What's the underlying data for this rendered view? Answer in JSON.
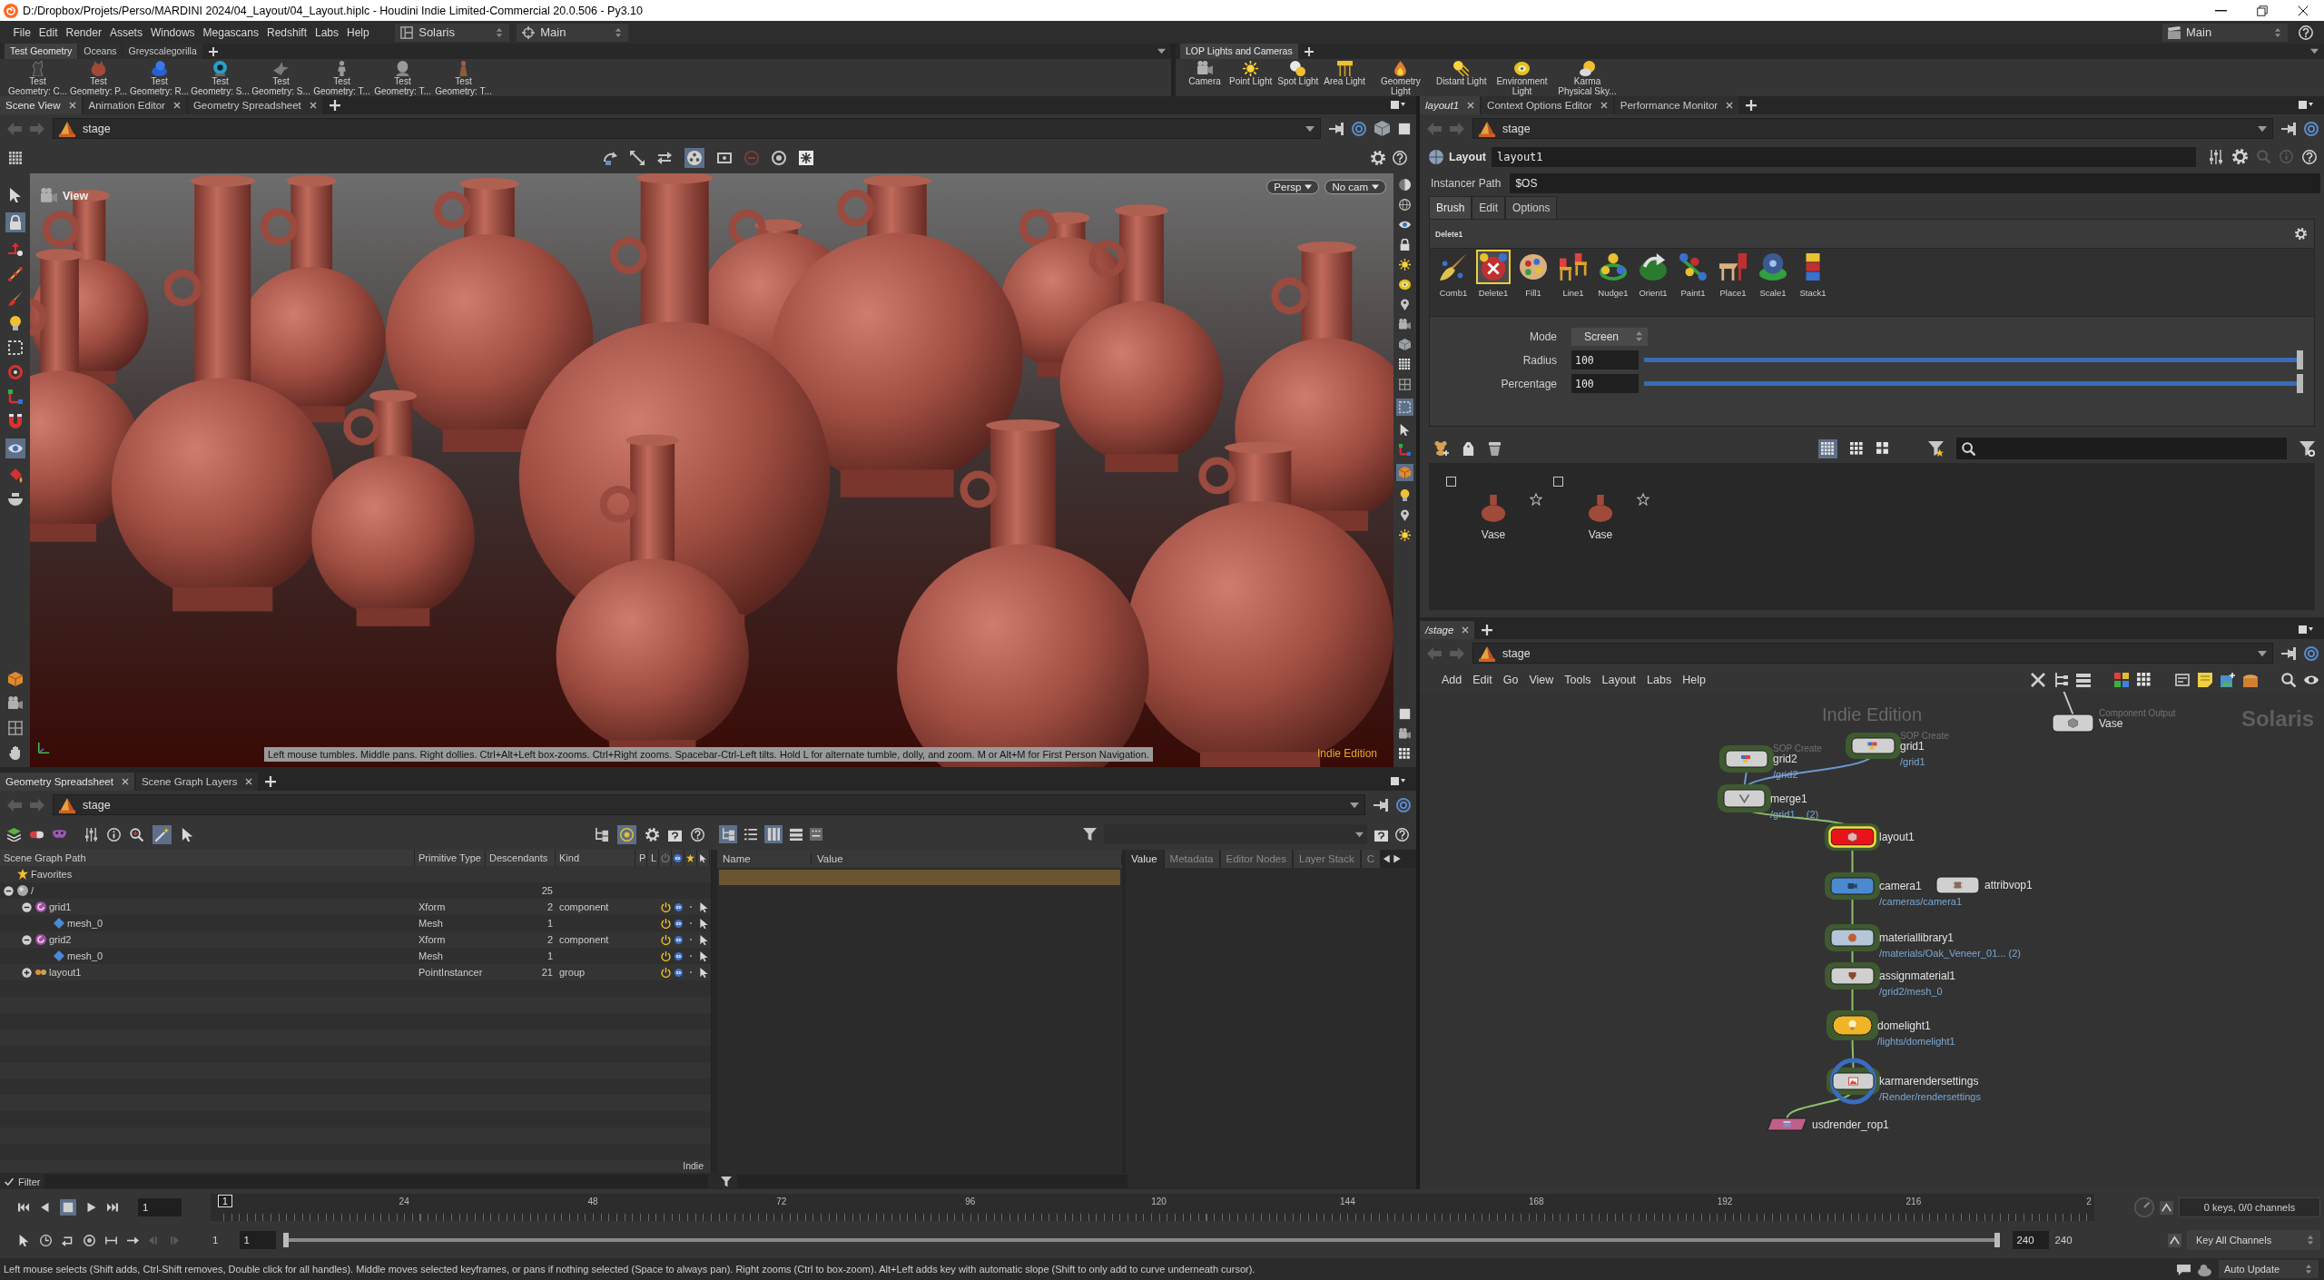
{
  "window": {
    "title": "D:/Dropbox/Projets/Perso/MARDINI 2024/04_Layout/04_Layout.hiplc - Houdini Indie Limited-Commercial 20.0.506 - Py3.10"
  },
  "menu_bar": {
    "items": [
      "File",
      "Edit",
      "Render",
      "Assets",
      "Windows",
      "Megascans",
      "Redshift",
      "Labs",
      "Help"
    ],
    "desktop": "Solaris",
    "context": "Main",
    "right_context": "Main"
  },
  "shelves": [
    {
      "tabs": [
        {
          "label": "Test Geometry",
          "selected": true
        },
        {
          "label": "Oceans",
          "selected": false
        },
        {
          "label": "Greyscalegorilla",
          "selected": false
        }
      ],
      "tools": [
        {
          "label": "Test Geometry: C...",
          "kind": "creature"
        },
        {
          "label": "Test Geometry: P...",
          "kind": "pig"
        },
        {
          "label": "Test Geometry: R...",
          "kind": "toy"
        },
        {
          "label": "Test Geometry: S...",
          "kind": "ball"
        },
        {
          "label": "Test Geometry: S...",
          "kind": "bird"
        },
        {
          "label": "Test Geometry: T...",
          "kind": "figure"
        },
        {
          "label": "Test Geometry: T...",
          "kind": "bust"
        },
        {
          "label": "Test Geometry: T...",
          "kind": "statue"
        }
      ]
    },
    {
      "tabs": [
        {
          "label": "LOP Lights and Cameras",
          "selected": true
        }
      ],
      "tools": [
        {
          "label": "Camera",
          "kind": "camera"
        },
        {
          "label": "Point Light",
          "kind": "sun"
        },
        {
          "label": "Spot Light",
          "kind": "spot"
        },
        {
          "label": "Area Light",
          "kind": "area"
        },
        {
          "label": "Geometry Light",
          "kind": "geolight"
        },
        {
          "label": "Distant Light",
          "kind": "distant"
        },
        {
          "label": "Environment Light",
          "kind": "env"
        },
        {
          "label": "Karma Physical Sky...",
          "kind": "sky"
        }
      ]
    }
  ],
  "scene_view": {
    "tabs": [
      {
        "label": "Scene View",
        "selected": true
      },
      {
        "label": "Animation Editor",
        "selected": false
      },
      {
        "label": "Geometry Spreadsheet",
        "selected": false
      }
    ],
    "path": "stage",
    "toolbar": [
      {
        "kind": "tumble",
        "selected": false
      },
      {
        "kind": "pan",
        "selected": false
      },
      {
        "kind": "dolly",
        "selected": false
      },
      {
        "kind": "reel",
        "selected": true
      },
      {
        "kind": "frame2",
        "selected": false
      },
      {
        "kind": "noentry",
        "selected": false
      },
      {
        "kind": "ring",
        "selected": false
      },
      {
        "kind": "snowflake",
        "selected": false
      }
    ],
    "left_toolbar": {
      "top": [
        {
          "kind": "select",
          "selected": false
        },
        {
          "kind": "lock",
          "selected": true
        },
        {
          "kind": "move",
          "selected": false
        },
        {
          "kind": "pose",
          "selected": false
        },
        {
          "kind": "brush",
          "selected": false
        },
        {
          "kind": "bulb",
          "selected": false
        },
        {
          "kind": "boxsel",
          "selected": false
        },
        {
          "kind": "rotate",
          "selected": false
        },
        {
          "kind": "scale",
          "selected": false
        },
        {
          "kind": "magnet",
          "selected": false
        },
        {
          "kind": "eye",
          "selected": true
        },
        {
          "kind": "paintcan",
          "selected": false
        },
        {
          "kind": "bowl",
          "selected": false
        }
      ],
      "bottom": [
        {
          "kind": "box",
          "selected": false
        },
        {
          "kind": "camera",
          "selected": false
        },
        {
          "kind": "grid",
          "selected": false
        },
        {
          "kind": "hand",
          "selected": false
        }
      ]
    },
    "right_toolbar": {
      "top": [
        {
          "kind": "shade",
          "selected": false
        },
        {
          "kind": "wire",
          "selected": false
        },
        {
          "kind": "eye",
          "selected": false
        },
        {
          "kind": "lock",
          "selected": false
        },
        {
          "kind": "sun",
          "selected": false
        },
        {
          "kind": "env",
          "selected": false
        },
        {
          "kind": "pinv",
          "selected": false
        },
        {
          "kind": "camera",
          "selected": false
        },
        {
          "kind": "cube",
          "selected": false
        },
        {
          "kind": "dense",
          "selected": false
        },
        {
          "kind": "grid",
          "selected": false
        },
        {
          "kind": "boxsel",
          "selected": true
        },
        {
          "kind": "select",
          "selected": false
        },
        {
          "kind": "scale",
          "selected": false
        },
        {
          "kind": "box",
          "selected": true
        },
        {
          "kind": "bulb",
          "selected": false
        },
        {
          "kind": "pinv",
          "selected": false
        },
        {
          "kind": "sun",
          "selected": false
        }
      ],
      "bottom": [
        {
          "kind": "square",
          "selected": false
        },
        {
          "kind": "camera",
          "selected": false
        },
        {
          "kind": "grid3",
          "selected": false
        }
      ]
    },
    "viewport": {
      "view_menu": "View",
      "projection": "Persp",
      "camera": "No cam",
      "hint": "Left mouse tumbles. Middle pans. Right dollies. Ctrl+Alt+Left box-zooms. Ctrl+Right zooms. Spacebar-Ctrl-Left tilts. Hold L for alternate tumble, dolly, and zoom. M or Alt+M for First Person Navigation.",
      "edition": "Indie Edition"
    }
  },
  "scene_graph": {
    "tabs": [
      {
        "label": "Geometry Spreadsheet",
        "selected": true
      },
      {
        "label": "Scene Graph Layers",
        "selected": false
      }
    ],
    "path": "stage",
    "toolbar": [
      {
        "kind": "layers",
        "selected": false
      },
      {
        "kind": "capsule",
        "selected": false
      },
      {
        "kind": "mask",
        "selected": false
      },
      {
        "kind": "sliders",
        "selected": false
      },
      {
        "kind": "infob",
        "selected": false
      },
      {
        "kind": "zoomin",
        "selected": false
      },
      {
        "kind": "wand",
        "selected": true
      },
      {
        "kind": "select",
        "selected": false
      }
    ],
    "toolbar_right": [
      {
        "kind": "hier",
        "selected": false
      },
      {
        "kind": "ytarget",
        "selected": true
      },
      {
        "kind": "gear",
        "selected": false
      },
      {
        "kind": "qbox",
        "selected": false
      },
      {
        "kind": "help",
        "selected": false
      }
    ],
    "columns": [
      "Scene Graph Path",
      "Primitive Type",
      "Descendants",
      "Kind",
      "P",
      "L"
    ],
    "tree": [
      {
        "name": "Favorites",
        "kind": "favorites"
      },
      {
        "name": "/",
        "kind": "root",
        "descendants": "25",
        "expanded": true,
        "children": [
          {
            "name": "grid1",
            "kind": "component",
            "primitive_type": "Xform",
            "descendants": "2",
            "usd_kind": "component",
            "expanded": true,
            "active": true,
            "visible": true,
            "children": [
              {
                "name": "mesh_0",
                "kind": "mesh",
                "primitive_type": "Mesh",
                "descendants": "1",
                "active": true,
                "visible": true
              }
            ]
          },
          {
            "name": "grid2",
            "kind": "component",
            "primitive_type": "Xform",
            "descendants": "2",
            "usd_kind": "component",
            "expanded": true,
            "active": true,
            "visible": true,
            "children": [
              {
                "name": "mesh_0",
                "kind": "mesh",
                "primitive_type": "Mesh",
                "descendants": "1",
                "active": true,
                "visible": true
              }
            ]
          },
          {
            "name": "layout1",
            "kind": "instancer",
            "primitive_type": "PointInstancer",
            "descendants": "21",
            "usd_kind": "group",
            "expanded": false,
            "active": true,
            "visible": true
          }
        ]
      }
    ],
    "footer": "Indie",
    "inspector_toolbar": [
      {
        "kind": "hier",
        "selected": true
      },
      {
        "kind": "list",
        "selected": false
      },
      {
        "kind": "columns",
        "selected": true
      },
      {
        "kind": "rows",
        "selected": false
      },
      {
        "kind": "trs",
        "selected": false
      }
    ],
    "inspector_columns": [
      "Name",
      "Value"
    ],
    "inspector_rows": [
      {
        "selected": true
      }
    ],
    "detail_tabs": [
      {
        "label": "Value",
        "selected": true
      },
      {
        "label": "Metadata",
        "selected": false
      },
      {
        "label": "Editor Nodes",
        "selected": false
      },
      {
        "label": "Layer Stack",
        "selected": false
      },
      {
        "label": "C",
        "selected": false
      }
    ],
    "filter": "Filter"
  },
  "parameters": {
    "tabs": [
      {
        "label": "layout1",
        "selected": true
      },
      {
        "label": "Context Options Editor",
        "selected": false
      },
      {
        "label": "Performance Monitor",
        "selected": false
      }
    ],
    "path": "stage",
    "node_type": "Layout",
    "node_name": "layout1",
    "instancer_label": "Instancer Path",
    "instancer_value": "$OS",
    "brush_tabs": [
      {
        "label": "Brush",
        "selected": true
      },
      {
        "label": "Edit",
        "selected": false
      },
      {
        "label": "Options",
        "selected": false
      }
    ],
    "active_brush": "Delete1",
    "brushes": [
      {
        "label": "Comb1",
        "kind": "comb",
        "selected": false
      },
      {
        "label": "Delete1",
        "kind": "del",
        "selected": true
      },
      {
        "label": "Fill1",
        "kind": "fill",
        "selected": false
      },
      {
        "label": "Line1",
        "kind": "line",
        "selected": false
      },
      {
        "label": "Nudge1",
        "kind": "nudge",
        "selected": false
      },
      {
        "label": "Orient1",
        "kind": "orient",
        "selected": false
      },
      {
        "label": "Paint1",
        "kind": "paint",
        "selected": false
      },
      {
        "label": "Place1",
        "kind": "place",
        "selected": false
      },
      {
        "label": "Scale1",
        "kind": "scalebr",
        "selected": false
      },
      {
        "label": "Stack1",
        "kind": "stack",
        "selected": false
      }
    ],
    "fields": [
      {
        "label": "Mode",
        "kind": "menu",
        "value": "Screen"
      },
      {
        "label": "Radius",
        "kind": "slider",
        "value": "100",
        "level": 1
      },
      {
        "label": "Percentage",
        "kind": "slider",
        "value": "100",
        "level": 1
      }
    ],
    "view_modes": [
      {
        "kind": "dense",
        "selected": true
      },
      {
        "kind": "grid3",
        "selected": false
      },
      {
        "kind": "large",
        "selected": false
      }
    ],
    "assets": [
      {
        "label": "Vase",
        "checked": false,
        "favorite": false
      },
      {
        "label": "Vase",
        "checked": false,
        "favorite": false
      }
    ]
  },
  "network": {
    "tabs": [
      {
        "label": "/stage",
        "selected": true
      }
    ],
    "path": "stage",
    "menu": [
      "Add",
      "Edit",
      "Go",
      "View",
      "Tools",
      "Layout",
      "Labs",
      "Help"
    ],
    "edition": "Indie Edition",
    "context": "Solaris",
    "nodes": [
      {
        "name": "grid2",
        "type_label": "SOP Create",
        "path": "/grid2",
        "kind": "sop_create",
        "color": "#d0d0d0",
        "selected": false,
        "highlighted": true,
        "display": false
      },
      {
        "name": "grid1",
        "type_label": "SOP Create",
        "path": "/grid1",
        "kind": "sop_create",
        "color": "#d0d0d0",
        "selected": false,
        "highlighted": true,
        "display": false
      },
      {
        "name": "merge1",
        "path": "/grid1... (2)",
        "kind": "merge",
        "color": "#d0d0d0",
        "selected": false,
        "highlighted": true,
        "display": false
      },
      {
        "name": "layout1",
        "kind": "layout",
        "color": "#e8141a",
        "selected": true,
        "highlighted": true,
        "display": false
      },
      {
        "name": "camera1",
        "path": "/cameras/camera1",
        "kind": "camera",
        "color": "#4a8ad0",
        "selected": false,
        "highlighted": true,
        "display": false
      },
      {
        "name": "attribvop1",
        "kind": "attribvop",
        "color": "#d0d0d0",
        "selected": false,
        "highlighted": false,
        "display": false
      },
      {
        "name": "materiallibrary1",
        "path": "/materials/Oak_Veneer_01... (2)",
        "kind": "material_library",
        "color": "#b4c6d8",
        "selected": false,
        "highlighted": true,
        "display": false
      },
      {
        "name": "assignmaterial1",
        "path": "/grid2/mesh_0",
        "kind": "assign_material",
        "color": "#d0d0d0",
        "selected": false,
        "highlighted": true,
        "display": false
      },
      {
        "name": "domelight1",
        "path": "/lights/domelight1",
        "kind": "dome_light",
        "color": "#f0b428",
        "selected": false,
        "highlighted": true,
        "display": false
      },
      {
        "name": "karmarendersettings",
        "path": "/Render/rendersettings",
        "kind": "render_settings",
        "color": "#d0d0d0",
        "selected": false,
        "highlighted": true,
        "display": true
      },
      {
        "name": "usdrender_rop1",
        "kind": "render_rop",
        "color": "#c0608a",
        "selected": false,
        "highlighted": false,
        "display": false
      },
      {
        "name": "Vase",
        "type_label": "Component Output",
        "kind": "component_output",
        "color": "#d0d0d0",
        "selected": false,
        "highlighted": false,
        "display": false
      }
    ]
  },
  "timeline": {
    "playback": [
      {
        "kind": "first",
        "selected": false
      },
      {
        "kind": "stepb",
        "selected": false
      },
      {
        "kind": "stop",
        "selected": true
      },
      {
        "kind": "play",
        "selected": false
      },
      {
        "kind": "last",
        "selected": false
      }
    ],
    "frame": "1",
    "current_frame": "1",
    "ticks": [
      "24",
      "48",
      "72",
      "96",
      "120",
      "144",
      "168",
      "192",
      "216",
      "2"
    ],
    "start_frame": "1",
    "playback_start": "1",
    "range_slider": {
      "level": 1
    },
    "playback_end": "240",
    "end_frame": "240",
    "keys": "0 keys, 0/0 channels",
    "key_mode": "Key All Channels"
  },
  "status_bar": {
    "message": "Left mouse selects (Shift adds, Ctrl-Shift removes, Double click for all handles). Middle moves selected keyframes, or pans if nothing selected (Space to always pan). Right zooms (Ctrl to box-zoom). Alt+Left adds key with automatic slope (Shift to only add to curve underneath cursor).",
    "update_mode": "Auto Update"
  }
}
